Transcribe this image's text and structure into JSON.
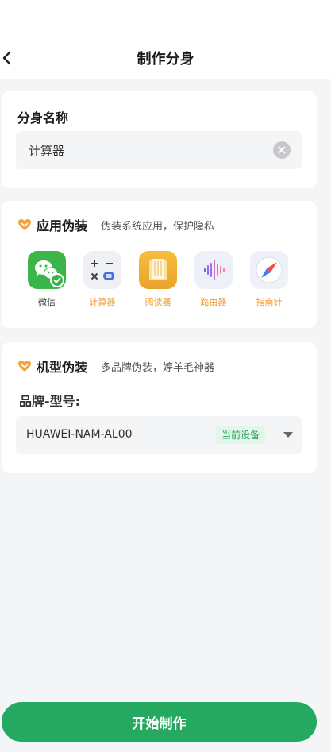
{
  "header": {
    "title": "制作分身",
    "back_icon": "chevron-left-icon"
  },
  "name_card": {
    "title": "分身名称",
    "input_value": "计算器",
    "clear_icon": "clear-circle-icon"
  },
  "app_card": {
    "title": "应用伪装",
    "description": "伪装系统应用，保护隐私",
    "apps": [
      {
        "label": "微信",
        "icon": "wechat-icon",
        "selected": true
      },
      {
        "label": "计算器",
        "icon": "calculator-icon",
        "selected": false
      },
      {
        "label": "阅读器",
        "icon": "reader-icon",
        "selected": false
      },
      {
        "label": "路由器",
        "icon": "router-icon",
        "selected": false
      },
      {
        "label": "指南针",
        "icon": "compass-icon",
        "selected": false
      }
    ]
  },
  "model_card": {
    "title": "机型伪装",
    "description": "多品牌伪装，婷羊毛神器",
    "brand_label": "品牌-型号:",
    "model_value": "HUAWEI-NAM-AL00",
    "badge": "当前设备"
  },
  "footer": {
    "start_label": "开始制作"
  },
  "colors": {
    "accent_green": "#25a961",
    "accent_orange": "#f19a2c",
    "badge_bg": "#e4f5e9",
    "badge_text": "#21a55a"
  }
}
